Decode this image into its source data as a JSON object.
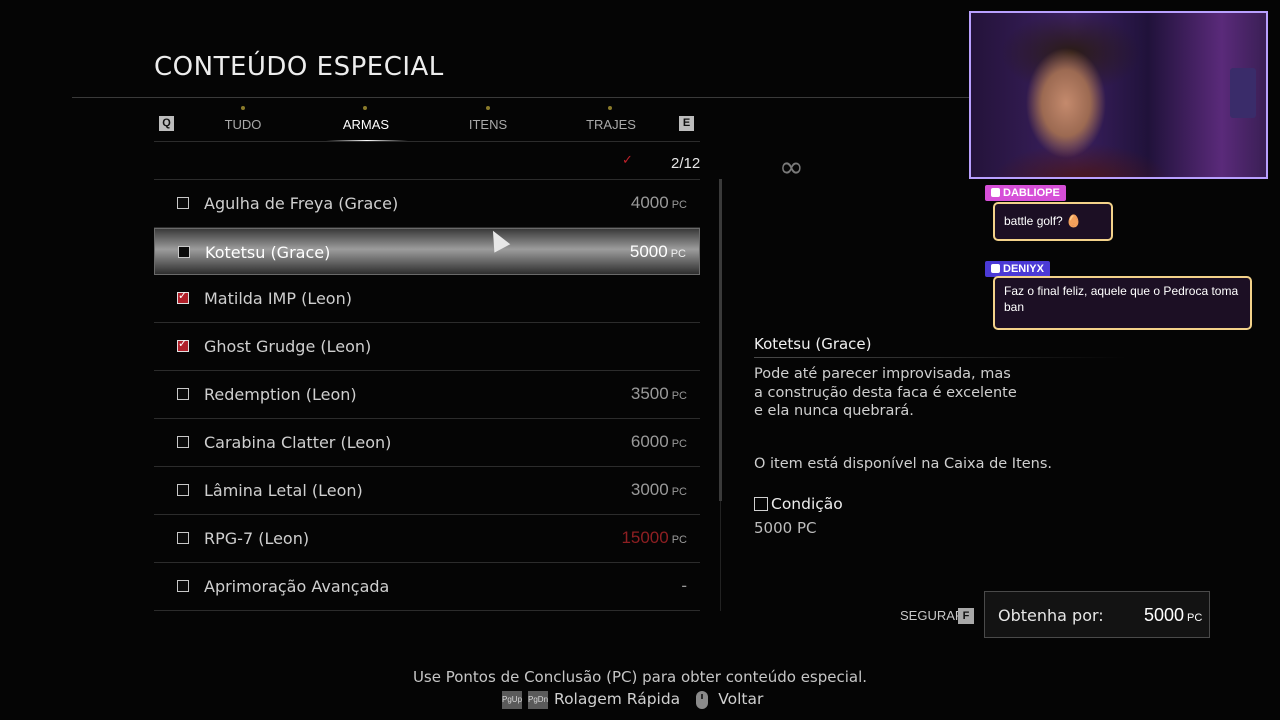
{
  "header": {
    "title": "CONTEÚDO ESPECIAL"
  },
  "tabs": {
    "prev_key": "Q",
    "next_key": "E",
    "items": [
      {
        "label": "TUDO",
        "active": false
      },
      {
        "label": "ARMAS",
        "active": true
      },
      {
        "label": "ITENS",
        "active": false
      },
      {
        "label": "TRAJES",
        "active": false
      }
    ]
  },
  "progress": {
    "count": "2/12"
  },
  "items": [
    {
      "label": "Agulha de Freya (Grace)",
      "price": "4000",
      "unit": "PC",
      "checked": false,
      "selected": false,
      "affordable": true
    },
    {
      "label": "Kotetsu (Grace)",
      "price": "5000",
      "unit": "PC",
      "checked": false,
      "selected": true,
      "affordable": true
    },
    {
      "label": "Matilda IMP (Leon)",
      "price": "",
      "unit": "",
      "checked": true,
      "selected": false,
      "affordable": true
    },
    {
      "label": "Ghost Grudge (Leon)",
      "price": "",
      "unit": "",
      "checked": true,
      "selected": false,
      "affordable": true
    },
    {
      "label": "Redemption (Leon)",
      "price": "3500",
      "unit": "PC",
      "checked": false,
      "selected": false,
      "affordable": true
    },
    {
      "label": "Carabina Clatter (Leon)",
      "price": "6000",
      "unit": "PC",
      "checked": false,
      "selected": false,
      "affordable": true
    },
    {
      "label": "Lâmina Letal (Leon)",
      "price": "3000",
      "unit": "PC",
      "checked": false,
      "selected": false,
      "affordable": true
    },
    {
      "label": "RPG-7 (Leon)",
      "price": "15000",
      "unit": "PC",
      "checked": false,
      "selected": false,
      "affordable": false
    },
    {
      "label": "Aprimoração Avançada",
      "price": "-",
      "unit": "",
      "checked": false,
      "selected": false,
      "affordable": true
    }
  ],
  "detail": {
    "infinity": "∞",
    "title": "Kotetsu (Grace)",
    "description": "Pode até parecer improvisada, mas\na construção desta faca é excelente\ne ela nunca quebrará.",
    "availability": "O item está disponível na Caixa de Itens.",
    "condition_label": "Condição",
    "condition_value": "5000 PC"
  },
  "purchase": {
    "hold_label": "SEGURAR",
    "hold_key": "F",
    "obtain_label": "Obtenha por:",
    "obtain_price": "5000",
    "obtain_unit": "PC"
  },
  "footer": {
    "hint": "Use Pontos de Conclusão (PC) para obter conteúdo especial.",
    "pgup": "PgUp",
    "pgdn": "PgDn",
    "fast_scroll": "Rolagem Rápida",
    "back": "Voltar"
  },
  "chat": [
    {
      "user": "DABLIOPE",
      "message": "battle golf? 🥚",
      "color": "#d64fd8"
    },
    {
      "user": "DENIYX",
      "message": "Faz o final feliz, aquele que o Pedroca toma ban",
      "color": "#4b3ad6"
    }
  ],
  "colors": {
    "accent_red": "#b0202a",
    "unaffordable": "#8e1f22",
    "chat_border": "#f3d28a"
  }
}
